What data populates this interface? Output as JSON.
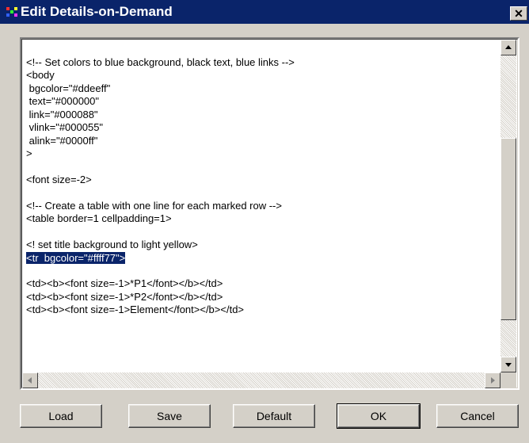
{
  "window": {
    "title": "Edit Details-on-Demand",
    "close_label": "✕"
  },
  "editor": {
    "lines": [
      "<!-- Set colors to blue background, black text, blue links -->",
      "<body",
      " bgcolor=\"#ddeeff\"",
      " text=\"#000000\"",
      " link=\"#000088\"",
      " vlink=\"#000055\"",
      " alink=\"#0000ff\"",
      ">",
      "",
      "<font size=-2>",
      "",
      "<!-- Create a table with one line for each marked row -->",
      "<table border=1 cellpadding=1>",
      "",
      "<! set title background to light yellow>",
      "<tr  bgcolor=\"#ffff77\">",
      "",
      "<td><b><font size=-1>*P1</font></b></td>",
      "<td><b><font size=-1>*P2</font></b></td>",
      "<td><b><font size=-1>Element</font></b></td>"
    ],
    "selected_line_index": 15,
    "selection_color": "#0a246a"
  },
  "buttons": {
    "load": "Load",
    "save": "Save",
    "default": "Default",
    "ok": "OK",
    "cancel": "Cancel"
  },
  "icons": {
    "app": "app-icon",
    "scroll_up": "arrow-up-icon",
    "scroll_down": "arrow-down-icon",
    "scroll_left": "arrow-left-icon",
    "scroll_right": "arrow-right-icon"
  },
  "colors": {
    "titlebar": "#0a246a",
    "face": "#d4d0c8",
    "editor_bg": "#ffffff"
  }
}
